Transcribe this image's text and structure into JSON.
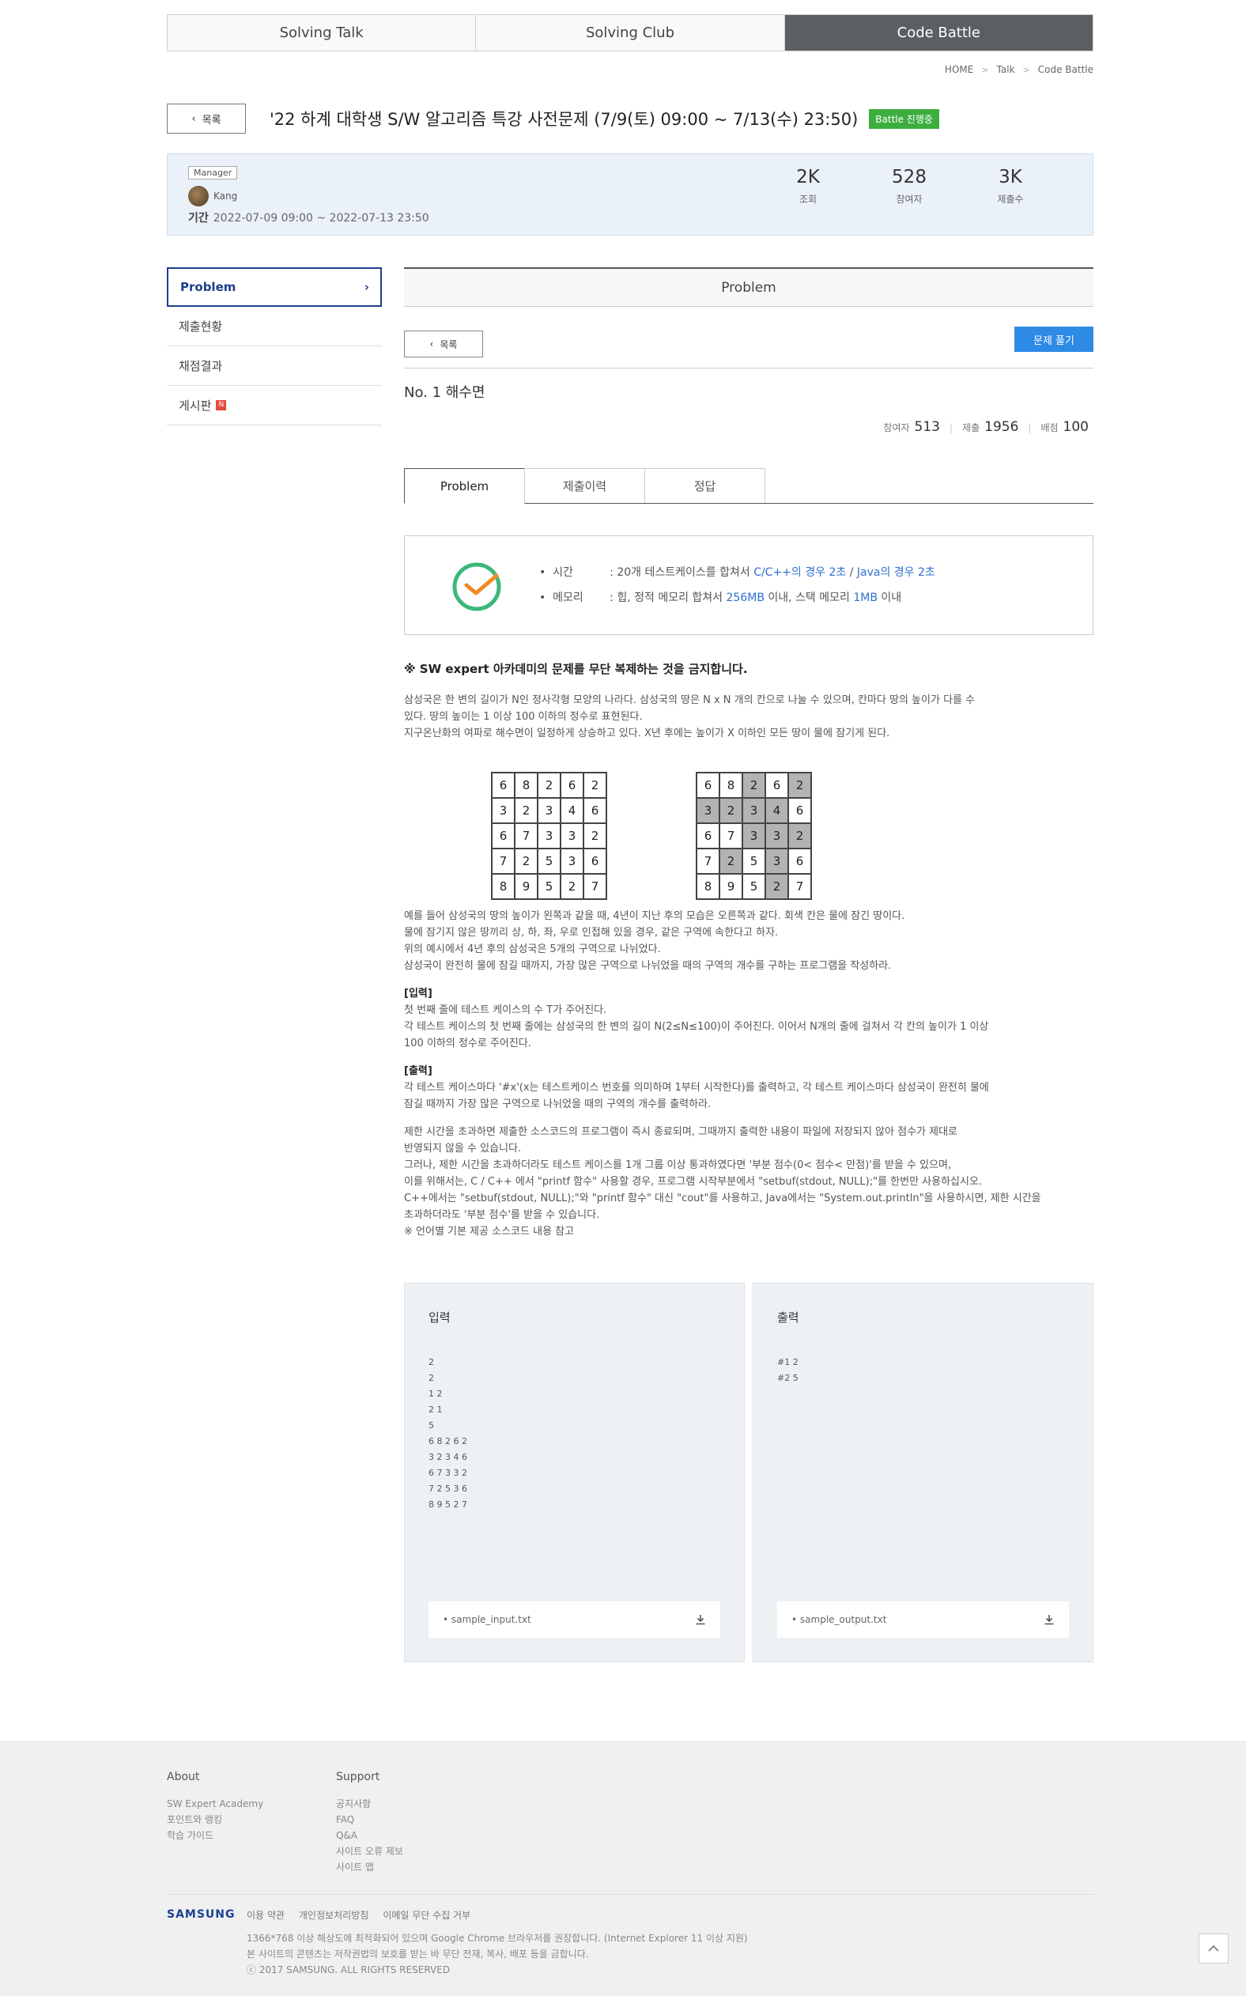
{
  "top_tabs": [
    "Solving Talk",
    "Solving Club",
    "Code Battle"
  ],
  "breadcrumb": [
    "HOME",
    "Talk",
    "Code Battle"
  ],
  "back_label": "목록",
  "title": "'22 하계 대학생 S/W 알고리즘 특강 사전문제 (7/9(토) 09:00 ~ 7/13(수) 23:50)",
  "status_badge": "Battle 진행중",
  "info": {
    "manager_badge": "Manager",
    "manager_name": "Kang",
    "period_label": "기간",
    "period": "2022-07-09 09:00 ~ 2022-07-13 23:50",
    "stats": [
      {
        "value": "2K",
        "label": "조회"
      },
      {
        "value": "528",
        "label": "참여자"
      },
      {
        "value": "3K",
        "label": "제출수"
      }
    ]
  },
  "side_menu": [
    "Problem",
    "제출현황",
    "채점결과",
    "게시판"
  ],
  "side_new_badge": "N",
  "main_header": "Problem",
  "list_btn": "목록",
  "solve_btn": "문제 풀기",
  "problem_title": "No. 1 해수면",
  "problem_stats": {
    "participants_label": "참여자",
    "participants": "513",
    "submit_label": "제출",
    "submit": "1956",
    "score_label": "배점",
    "score": "100"
  },
  "problem_tabs": [
    "Problem",
    "제출이력",
    "정답"
  ],
  "limits": {
    "time_key": "시간",
    "time_pre": ": 20개 테스트케이스를 합쳐서 ",
    "time_c": "C/C++의 경우 2초",
    "time_sep": " / ",
    "time_java": "Java의 경우 2초",
    "mem_key": "메모리",
    "mem_pre": ": 힙, 정적 메모리 합쳐서 ",
    "mem_heap": "256MB",
    "mem_mid": " 이내, 스택 메모리 ",
    "mem_stack": "1MB",
    "mem_post": " 이내"
  },
  "content": {
    "warning": "※ SW expert 아카데미의 문제를 무단 복제하는 것을 금지합니다.",
    "intro": [
      "삼성국은 한 변의 길이가 N인 정사각형 모양의 나라다. 삼성국의 땅은 N x N 개의 칸으로 나눌 수 있으며, 칸마다 땅의 높이가 다를 수",
      "있다. 땅의 높이는 1 이상 100 이하의 정수로 표현된다.",
      "지구온난화의 여파로 해수면이 일정하게 상승하고 있다. X년 후에는 높이가 X 이하인 모든 땅이 물에 잠기게 된다."
    ],
    "grid_left": [
      [
        6,
        8,
        2,
        6,
        2
      ],
      [
        3,
        2,
        3,
        4,
        6
      ],
      [
        6,
        7,
        3,
        3,
        2
      ],
      [
        7,
        2,
        5,
        3,
        6
      ],
      [
        8,
        9,
        5,
        2,
        7
      ]
    ],
    "grid_right": [
      [
        6,
        8,
        2,
        6,
        2
      ],
      [
        3,
        2,
        3,
        4,
        6
      ],
      [
        6,
        7,
        3,
        3,
        2
      ],
      [
        7,
        2,
        5,
        3,
        6
      ],
      [
        8,
        9,
        5,
        2,
        7
      ]
    ],
    "after_grid": [
      "예를 들어 삼성국의 땅의 높이가 왼쪽과 같을 때, 4년이 지난 후의 모습은 오른쪽과 같다. 회색 칸은 물에 잠긴 땅이다.",
      "물에 잠기지 않은 땅끼리 상, 하, 좌, 우로 인접해 있을 경우, 같은 구역에 속한다고 하자.",
      "위의 예시에서 4년 후의 삼성국은 5개의 구역으로 나뉘었다.",
      "삼성국이 완전히 물에 잠길 때까지, 가장 많은 구역으로 나뉘었을 때의 구역의 개수를 구하는 프로그램을 작성하라."
    ],
    "input_head": "[입력]",
    "input_lines": [
      "첫 번째 줄에 테스트 케이스의 수 T가 주어진다.",
      "각 테스트 케이스의 첫 번째 줄에는 삼성국의 한 변의 길이 N(2≤N≤100)이 주어진다. 이어서 N개의 줄에 걸쳐서 각 칸의 높이가 1 이상",
      "100 이하의 정수로 주어진다."
    ],
    "output_head": "[출력]",
    "output_lines": [
      "각 테스트 케이스마다 '#x'(x는 테스트케이스 번호를 의미하며 1부터 시작한다)를 출력하고, 각 테스트 케이스마다 삼성국이 완전히 물에",
      "잠길 때까지 가장 많은 구역으로 나뉘었을 때의 구역의 개수를 출력하라."
    ],
    "notes": [
      "제한 시간을 초과하면 제출한 소스코드의 프로그램이 즉시 종료되며, 그때까지 출력한 내용이 파일에 저장되지 않아 점수가 제대로",
      "반영되지 않을 수 있습니다.",
      "그러나, 제한 시간을 초과하더라도 테스트 케이스를 1개 그룹 이상 통과하였다면 '부분 점수(0< 점수< 만점)'를 받을 수 있으며,",
      "이를 위해서는, C / C++ 에서 \"printf 함수\" 사용할 경우, 프로그램 시작부분에서 \"setbuf(stdout, NULL);\"를 한번만 사용하십시오.",
      "C++에서는 \"setbuf(stdout, NULL);\"와 \"printf 함수\" 대신 \"cout\"를 사용하고, Java에서는 \"System.out.println\"을 사용하시면, 제한 시간을",
      "초과하더라도 '부분 점수'를 받을 수 있습니다.",
      "※ 언어별 기본 제공 소스코드 내용 참고"
    ]
  },
  "io": {
    "input_title": "입력",
    "input_data": "2\n2\n1 2\n2 1\n5\n6 8 2 6 2\n3 2 3 4 6\n6 7 3 3 2\n7 2 5 3 6\n8 9 5 2 7",
    "input_file": "sample_input.txt",
    "output_title": "출력",
    "output_data": "#1 2\n#2 5",
    "output_file": "sample_output.txt"
  },
  "footer": {
    "about_head": "About",
    "about_items": [
      "SW Expert Academy",
      "포인트와 랭킹",
      "학습 가이드"
    ],
    "support_head": "Support",
    "support_items": [
      "공지사항",
      "FAQ",
      "Q&A",
      "사이트 오류 제보",
      "사이트 맵"
    ],
    "logo": "SAMSUNG",
    "links": [
      "이용 약관",
      "개인정보처리방침",
      "이메일 무단 수집 거부"
    ],
    "notes": [
      "1366*768 이상 해상도에 최적화되어 있으며 Google Chrome 브라우저를 권장합니다. (Internet Explorer 11 이상 지원)",
      "본 사이트의 콘텐츠는 저작권법의 보호를 받는 바 무단 전재, 복사, 배포 등을 금합니다.",
      "ⓒ 2017 SAMSUNG. ALL RIGHTS RESERVED"
    ]
  }
}
